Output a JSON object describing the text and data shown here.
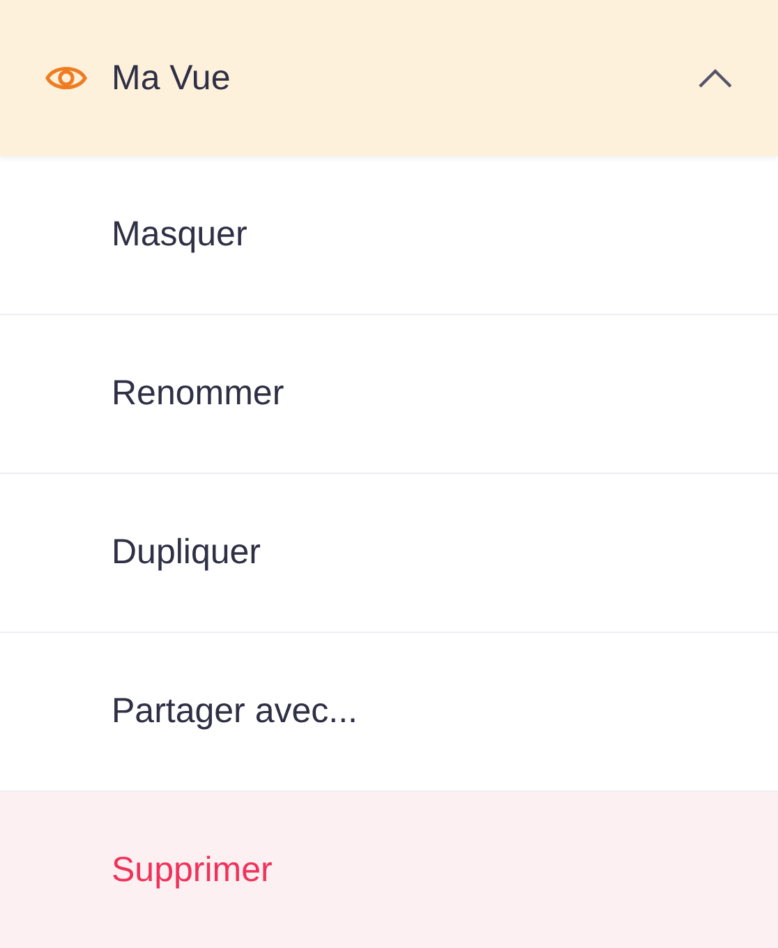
{
  "header": {
    "title": "Ma Vue",
    "expanded": true
  },
  "items": [
    {
      "label": "Masquer",
      "kind": "normal"
    },
    {
      "label": "Renommer",
      "kind": "normal"
    },
    {
      "label": "Dupliquer",
      "kind": "normal"
    },
    {
      "label": "Partager avec...",
      "kind": "normal"
    },
    {
      "label": "Supprimer",
      "kind": "danger"
    }
  ]
}
